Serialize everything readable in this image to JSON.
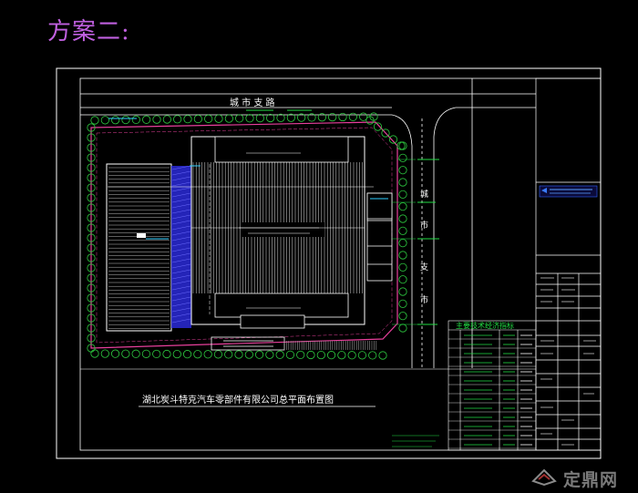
{
  "scheme_title": "方案二:",
  "drawing_title": "湖北炭斗特克汽车零部件有限公司总平面布置图",
  "roads": {
    "top_label": "城 市 支 路",
    "right_label_chars": [
      "城",
      "市",
      "支",
      "市"
    ]
  },
  "tech_table": {
    "title": "主要技术经济指标"
  },
  "watermark": {
    "text": "定鼎网"
  },
  "colors": {
    "background": "#000000",
    "frame": "#ffffff",
    "site_boundary": "#e8409c",
    "trees": "#2ecc40",
    "road_edge": "#ffffff",
    "building_hatch": "#cfcfcf",
    "green_text": "#22dd44",
    "cyan_text": "#30d0ff",
    "blue_strip": "#2a2ad8",
    "scheme_title": "#c060e0"
  },
  "icons": {
    "logo": "dingding-logo-icon",
    "north_arrow": "site-marker-icon"
  }
}
